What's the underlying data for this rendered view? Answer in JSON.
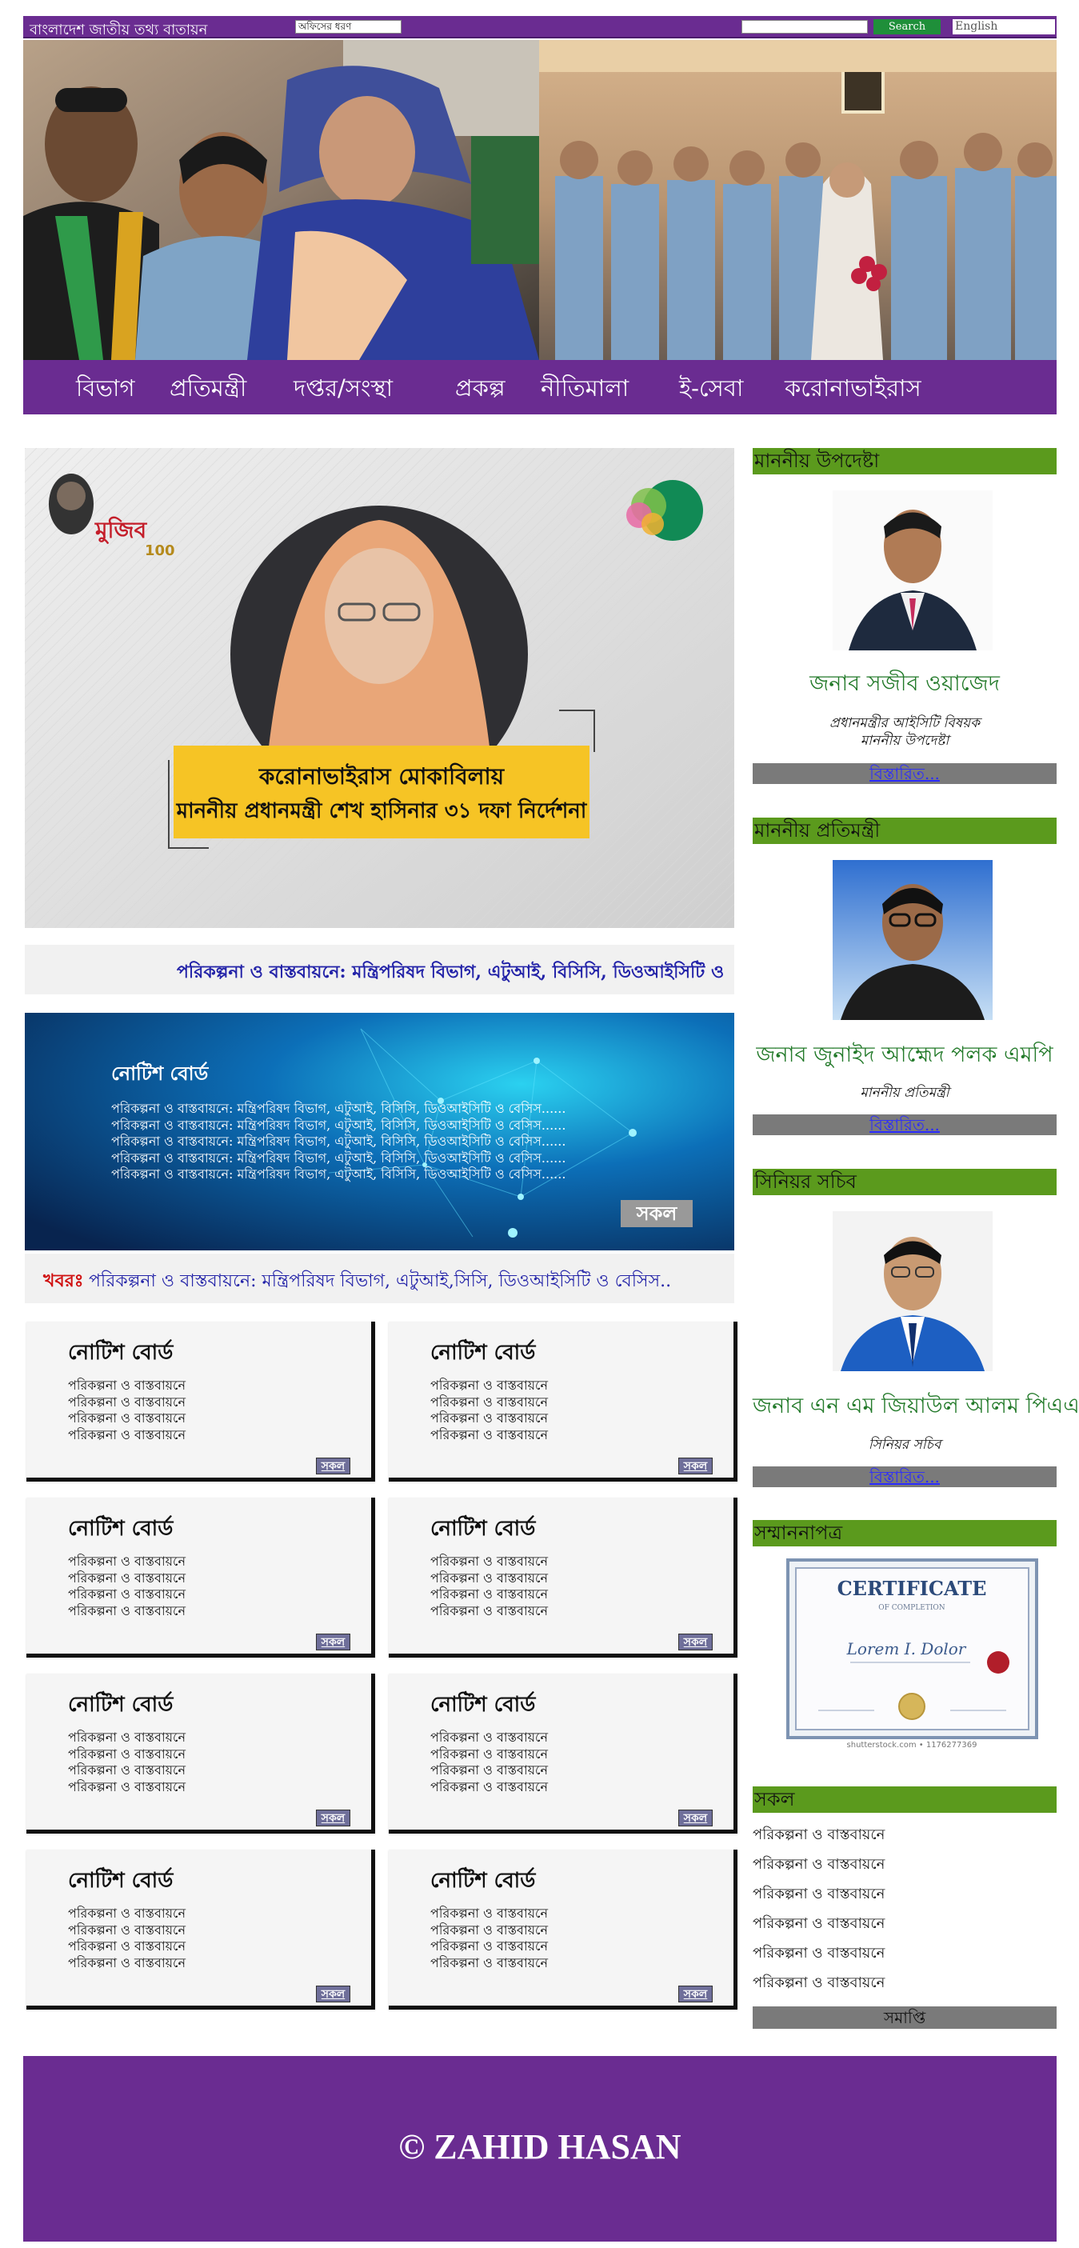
{
  "topbar": {
    "site_title": "বাংলাদেশ জাতীয় তথ্য বাতায়ন",
    "office_select_value": "অফিসের ধরণ",
    "search_button": "Search",
    "language_link": "English"
  },
  "nav": {
    "items": [
      "বিভাগ",
      "প্রতিমন্ত্রী",
      "দপ্তর/সংস্থা",
      "প্রকল্প",
      "নীতিমালা",
      "ই-সেবা",
      "করোনাভাইরাস"
    ]
  },
  "banner": {
    "logo_text": "মুজিব",
    "logo_badge": "100",
    "heading_line1": "করোনাভাইরাস মোকাবিলায়",
    "heading_line2": "মাননীয় প্রধানমন্ত্রী শেখ হাসিনার ৩১ দফা নির্দেশনা"
  },
  "marquee": {
    "text": "পরিকল্পনা ও বাস্তবায়নে: মন্ত্রিপরিষদ বিভাগ, এটুআই, বিসিসি, ডিওআইসিটি ও"
  },
  "notice_hero": {
    "title": "নোটিশ বোর্ড",
    "lines": [
      "পরিকল্পনা ও বাস্তবায়নে: মন্ত্রিপরিষদ বিভাগ, এটুআই, বিসিসি, ডিওআইসিটি ও বেসিস......",
      "পরিকল্পনা ও বাস্তবায়নে: মন্ত্রিপরিষদ বিভাগ, এটুআই, বিসিসি, ডিওআইসিটি ও বেসিস......",
      "পরিকল্পনা ও বাস্তবায়নে: মন্ত্রিপরিষদ বিভাগ, এটুআই, বিসিসি, ডিওআইসিটি ও বেসিস......",
      "পরিকল্পনা ও বাস্তবায়নে: মন্ত্রিপরিষদ বিভাগ, এটুআই, বিসিসি, ডিওআইসিটি ও বেসিস......",
      "পরিকল্পনা ও বাস্তবায়নে: মন্ত্রিপরিষদ বিভাগ, এটুআই, বিসিসি, ডিওআইসিটি ও বেসিস......"
    ],
    "button": "সকল"
  },
  "ticker": {
    "label": "খবরঃ",
    "text": "পরিকল্পনা ও বাস্তবায়নে: মন্ত্রিপরিষদ বিভাগ, এটুআই,সিসি, ডিওআইসিটি ও বেসিস.."
  },
  "cards": {
    "title": "নোটিশ বোর্ড",
    "line": "পরিকল্পনা ও বাস্তবায়নে",
    "button": "সকল"
  },
  "sidebar": {
    "adviser": {
      "heading": "মাননীয় উপদেষ্টা",
      "name": "জনাব সজীব ওয়াজেদ",
      "role_line1": "প্রধানমন্ত্রীর আইসিটি বিষয়ক",
      "role_line2": "মাননীয় উপদেষ্টা",
      "more": "বিস্তারিত..."
    },
    "state_minister": {
      "heading": "মাননীয় প্রতিমন্ত্রী",
      "name": "জনাব জুনাইদ আহ্মেদ পলক এমপি",
      "role": "মাননীয় প্রতিমন্ত্রী",
      "more": "বিস্তারিত..."
    },
    "secretary": {
      "heading": "সিনিয়র সচিব",
      "name": "জনাব এন এম জিয়াউল আলম পিএএ",
      "role": "সিনিয়র সচিব",
      "more": "বিস্তারিত..."
    },
    "certificate": {
      "heading": "সম্মাননাপত্র",
      "title": "CERTIFICATE",
      "subtitle": "OF COMPLETION",
      "signature": "Lorem I. Dolor",
      "credit": "shutterstock.com • 1176277369"
    },
    "all": {
      "heading": "সকল",
      "items": [
        "পরিকল্পনা ও বাস্তবায়নে",
        "পরিকল্পনা ও বাস্তবায়নে",
        "পরিকল্পনা ও বাস্তবায়নে",
        "পরিকল্পনা ও বাস্তবায়নে",
        "পরিকল্পনা ও বাস্তবায়নে",
        "পরিকল্পনা ও বাস্তবায়নে"
      ],
      "end": "সমাপ্তি"
    }
  },
  "footer": {
    "copyright": "© ZAHID HASAN"
  },
  "colors": {
    "brand_purple": "#6a2c91",
    "sidebar_green": "#5b9a1d",
    "name_green": "#237a2a",
    "link_blue": "#2b2bff",
    "ticker_red": "#d01010"
  }
}
